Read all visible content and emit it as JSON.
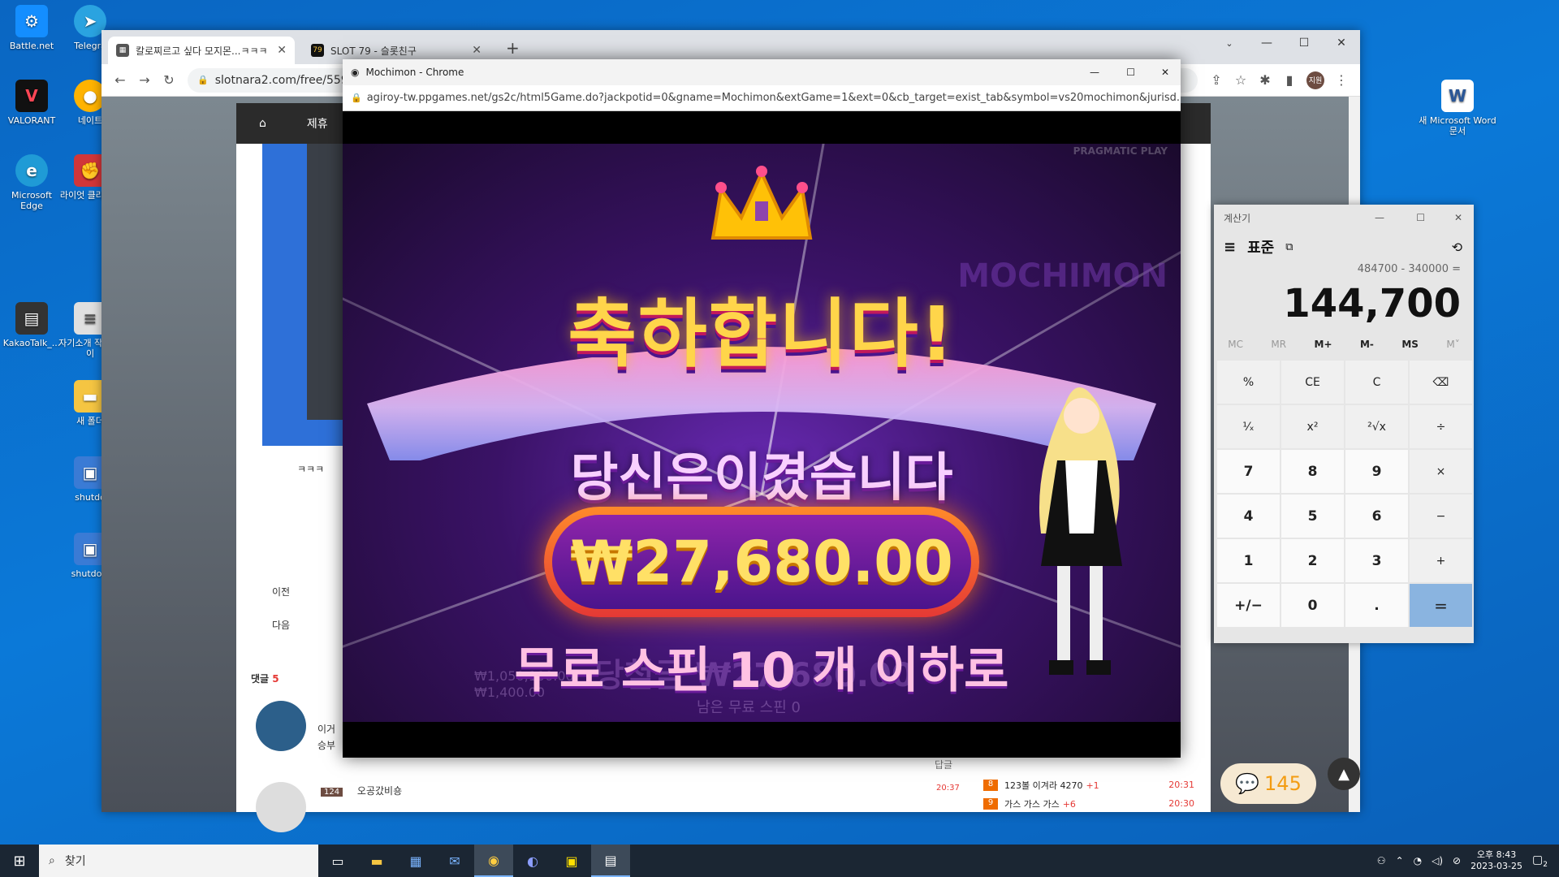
{
  "desktop": {
    "icons_left": [
      {
        "label": "Battle.net",
        "icon": "battlenet-icon",
        "color": "#148eff"
      },
      {
        "label": "VALORANT",
        "icon": "valorant-icon",
        "color": "#ff4655"
      },
      {
        "label": "Microsoft Edge",
        "icon": "edge-icon",
        "color": "#1f9bd6"
      },
      {
        "label": "KakaoTalk_...",
        "icon": "kakaotalk-icon",
        "color": "#333333"
      }
    ],
    "icons_col2": [
      {
        "label": "Telegra",
        "icon": "telegram-icon",
        "color": "#2aa3e0"
      },
      {
        "label": "네이트",
        "icon": "nate-icon",
        "color": "#ffb300"
      },
      {
        "label": "라이엇 클라이언",
        "icon": "riot-icon",
        "color": "#d13639"
      },
      {
        "label": "자기소개 작성 가이",
        "icon": "document-icon",
        "color": "#e0e0e0"
      },
      {
        "label": "새 폴더",
        "icon": "folder-icon",
        "color": "#f5c542"
      },
      {
        "label": "shutdo",
        "icon": "shutdown-shortcut-icon",
        "color": "#3a7bd5"
      },
      {
        "label": "shutdow",
        "icon": "shutdown-shortcut-icon",
        "color": "#3a7bd5"
      }
    ],
    "icon_right": {
      "label": "새 Microsoft Word 문서",
      "icon": "word-icon",
      "color": "#2b5797"
    }
  },
  "chrome_main": {
    "tabs": [
      {
        "title": "칼로찌르고 싶다 모지몬...ㅋㅋㅋ",
        "favicon": "slotnara-favicon"
      },
      {
        "title": "SLOT 79 - 슬롯친구",
        "favicon": "slot79-favicon",
        "fav_text": "79"
      }
    ],
    "url": "slotnara2.com/free/5593",
    "profile_label": "지원",
    "site": {
      "nav_item": "제휴",
      "prev_label": "이전",
      "next_label": "다음",
      "laugh_text": "ㅋㅋㅋ",
      "comments_label": "댓글",
      "comments_count": "5",
      "comment_text_1": "이거",
      "comment_text_2": "승부",
      "reply_label": "답글",
      "comment_time": "20:37",
      "commenter_level": "124",
      "commenter_name": "오공갔비숑",
      "side_list": [
        {
          "rank": "8",
          "title": "123볼 이겨라 4270",
          "plus": "+1",
          "time": "20:31"
        },
        {
          "rank": "9",
          "title": "가스 가스 가스",
          "plus": "+6",
          "time": "20:30"
        }
      ]
    }
  },
  "popup": {
    "window_title": "Mochimon - Chrome",
    "url": "agiroy-tw.ppgames.net/gs2c/html5Game.do?jackpotid=0&gname=Mochimon&extGame=1&ext=0&cb_target=exist_tab&symbol=vs20mochimon&jurisd...",
    "game": {
      "provider_text": "PRAGMATIC PLAY",
      "logo_text": "MOCHIMON",
      "congrats": "축하합니다!",
      "you_won": "당신은이겼습니다",
      "amount": "₩27,680.00",
      "free_spins": "무료 스핀 10 개 이하로",
      "bg_win_text": "당첨금 ₩27,680.00",
      "bg_remaining": "남은 무료 스핀 0",
      "bg_credit": "₩1,050,100.00",
      "bg_bet": "₩1,400.00"
    }
  },
  "calculator": {
    "title": "계산기",
    "mode": "표준",
    "expression": "484700 - 340000 =",
    "display": "144,700",
    "memory": [
      "MC",
      "MR",
      "M+",
      "M-",
      "MS",
      "M˅"
    ],
    "keys": [
      "%",
      "CE",
      "C",
      "⌫",
      "¹⁄ₓ",
      "x²",
      "²√x",
      "÷",
      "7",
      "8",
      "9",
      "×",
      "4",
      "5",
      "6",
      "−",
      "1",
      "2",
      "3",
      "+",
      "+/−",
      "0",
      ".",
      "="
    ]
  },
  "chat_count": "145",
  "taskbar": {
    "search_placeholder": "찾기",
    "time": "오후 8:43",
    "date": "2023-03-25",
    "notification_count": "2"
  }
}
